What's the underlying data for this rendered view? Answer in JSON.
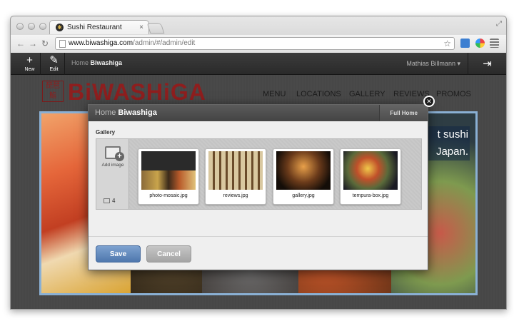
{
  "browser": {
    "tab_title": "Sushi Restaurant",
    "url_host": "www.biwashiga.com",
    "url_path": "/admin/#/admin/edit"
  },
  "admin_bar": {
    "new_label": "New",
    "edit_label": "Edit",
    "crumb_home": "Home",
    "crumb_current": "Biwashiga",
    "user_name": "Mathias Billmann"
  },
  "site": {
    "logo_text": "BiWASHiGA",
    "nav": [
      "MENU",
      "LOCATIONS",
      "GALLERY",
      "REVIEWS",
      "PROMOS"
    ],
    "hero_text_line1": "t sushi",
    "hero_text_line2": "Japan."
  },
  "overlay": {
    "crumb_home": "Home",
    "crumb_current": "Biwashiga",
    "full_home_label": "Full Home",
    "section_label": "Gallery",
    "add_image_label": "Add image",
    "image_count": "4",
    "images": [
      {
        "filename": "photo-mosaic.jpg"
      },
      {
        "filename": "reviews.jpg"
      },
      {
        "filename": "gallery.jpg"
      },
      {
        "filename": "tempura-box.jpg"
      }
    ],
    "save_label": "Save",
    "cancel_label": "Cancel"
  },
  "colors": {
    "accent_blue": "#5b82b8",
    "logo_red": "#8e1e1e",
    "admin_bar": "#333333"
  }
}
